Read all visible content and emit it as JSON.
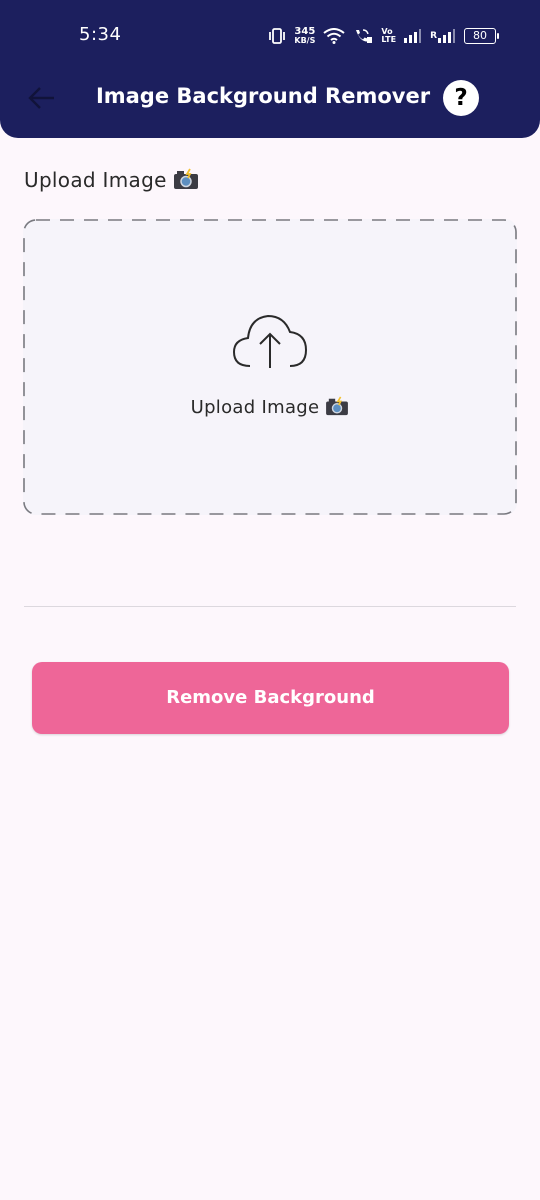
{
  "status_bar": {
    "time": "5:34",
    "net_speed": "345",
    "net_speed_unit": "KB/S",
    "volte_line1": "Vo",
    "volte_line2": "LTE",
    "roaming": "R",
    "battery": "80"
  },
  "app_bar": {
    "title": "Image Background Remover",
    "help_label": "?"
  },
  "upload": {
    "section_label": "Upload Image",
    "box_label": "Upload Image"
  },
  "actions": {
    "remove_background": "Remove Background"
  },
  "colors": {
    "app_bar": "#1c1f5e",
    "background": "#fdf7fc",
    "button": "#ee6698"
  }
}
